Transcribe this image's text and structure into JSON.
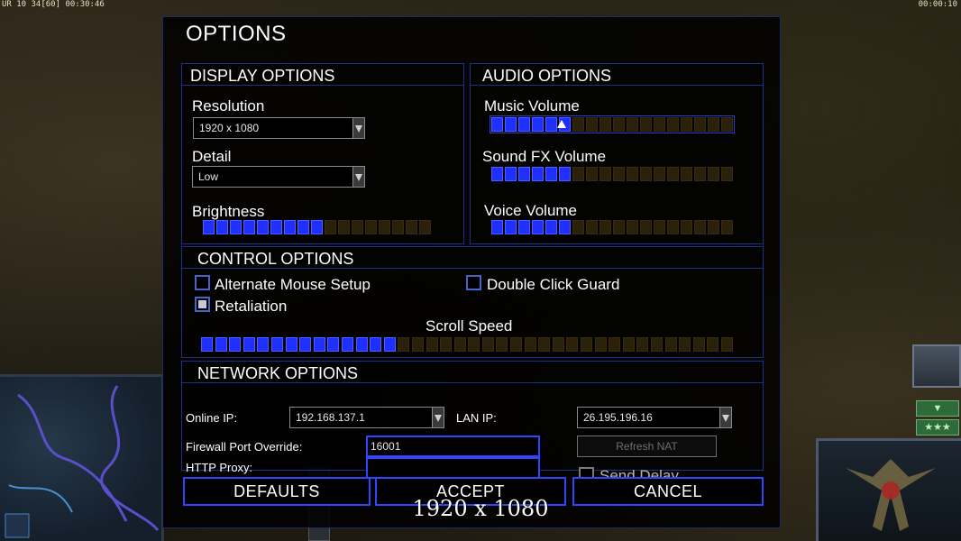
{
  "hud": {
    "top_left": "UR 10 34[60] 00:30:46",
    "top_right": "00:00:10"
  },
  "dialog": {
    "title": "OPTIONS",
    "display": {
      "header": "DISPLAY OPTIONS",
      "resolution_label": "Resolution",
      "resolution_value": "1920 x 1080",
      "detail_label": "Detail",
      "detail_value": "Low",
      "brightness_label": "Brightness",
      "brightness_level": 9,
      "brightness_segments": 17
    },
    "audio": {
      "header": "AUDIO OPTIONS",
      "music_label": "Music Volume",
      "music_level": 6,
      "music_segments": 18,
      "sfx_label": "Sound FX Volume",
      "sfx_level": 6,
      "sfx_segments": 18,
      "voice_label": "Voice Volume",
      "voice_level": 6,
      "voice_segments": 18
    },
    "control": {
      "header": "CONTROL OPTIONS",
      "alt_mouse_label": "Alternate Mouse Setup",
      "alt_mouse_checked": false,
      "double_click_label": "Double Click Guard",
      "double_click_checked": false,
      "retaliation_label": "Retaliation",
      "retaliation_checked": true,
      "scroll_label": "Scroll Speed",
      "scroll_level": 14,
      "scroll_segments": 38
    },
    "network": {
      "header": "NETWORK OPTIONS",
      "online_ip_label": "Online IP:",
      "online_ip_value": "192.168.137.1",
      "lan_ip_label": "LAN IP:",
      "lan_ip_value": "26.195.196.16",
      "firewall_label": "Firewall Port Override:",
      "firewall_value": "16001",
      "proxy_label": "HTTP Proxy:",
      "proxy_value": "",
      "refresh_nat_label": "Refresh NAT",
      "send_delay_label": "Send Delay",
      "send_delay_checked": false
    },
    "buttons": {
      "defaults": "DEFAULTS",
      "accept": "ACCEPT",
      "cancel": "CANCEL"
    }
  },
  "overlay": {
    "resolution_text": "1920 x 1080"
  },
  "colors": {
    "accent": "#2d46ff",
    "slider_on": "#1e2fff",
    "slider_off": "#2b210b"
  }
}
